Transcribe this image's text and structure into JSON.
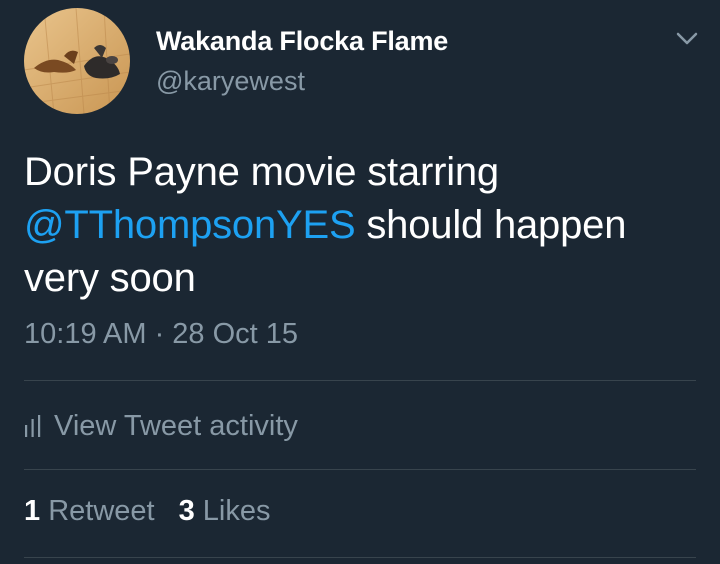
{
  "colors": {
    "background": "#1b2733",
    "primary_text": "#ffffff",
    "secondary_text": "#8899a6",
    "link": "#1da1f2",
    "divider": "#38444d"
  },
  "author": {
    "display_name": "Wakanda Flocka Flame",
    "handle": "@karyewest",
    "avatar_icon": "profile-photo"
  },
  "tweet": {
    "text_before": "Doris Payne movie starring ",
    "mention": "@TThompsonYES",
    "text_after": " should happen very soon",
    "timestamp": "10:19 AM · 28 Oct 15"
  },
  "actions": {
    "menu_icon": "chevron-down-icon",
    "activity_icon": "bar-chart-icon",
    "activity_label": "View Tweet activity"
  },
  "stats": {
    "retweets_count": "1",
    "retweets_label": "Retweet",
    "likes_count": "3",
    "likes_label": "Likes"
  }
}
